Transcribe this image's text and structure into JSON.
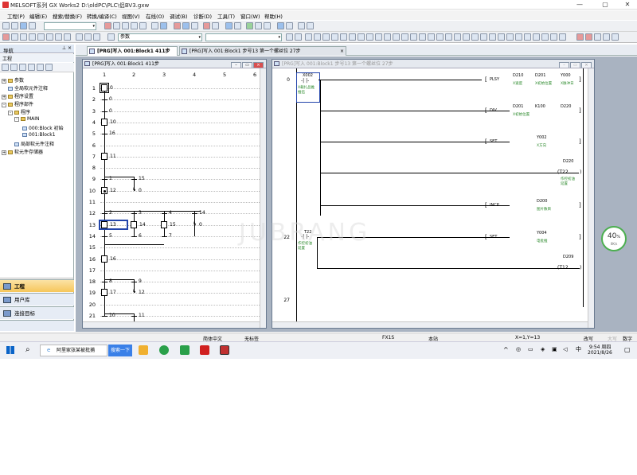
{
  "window": {
    "title": "MELSOFT系列 GX Works2 D:\\oldPC\\PLC\\侣BV3.gxw",
    "min": "—",
    "max": "▢",
    "close": "✕"
  },
  "menu": [
    "工程(P)",
    "编辑(E)",
    "搜索/替换(F)",
    "转换/编译(C)",
    "视图(V)",
    "在线(O)",
    "调试(B)",
    "诊断(D)",
    "工具(T)",
    "窗口(W)",
    "帮助(H)"
  ],
  "toolbar": {
    "combo2_value": "参数"
  },
  "nav": {
    "header": "导航",
    "pin": "⊥ ×",
    "section": "工程",
    "tree": [
      {
        "label": "参数",
        "indent": 0,
        "exp": "+",
        "icon": "folder"
      },
      {
        "label": "全局软元件注释",
        "indent": 0,
        "exp": "",
        "icon": "doc"
      },
      {
        "label": "程序设置",
        "indent": 0,
        "exp": "+",
        "icon": "folder"
      },
      {
        "label": "程序部件",
        "indent": 0,
        "exp": "-",
        "icon": "folder"
      },
      {
        "label": "程序",
        "indent": 1,
        "exp": "-",
        "icon": "folder"
      },
      {
        "label": "MAIN",
        "indent": 2,
        "exp": "-",
        "icon": "folder"
      },
      {
        "label": "000:Block  初始",
        "indent": 3,
        "exp": "",
        "icon": "doc"
      },
      {
        "label": "001:Block1",
        "indent": 3,
        "exp": "",
        "icon": "doc"
      },
      {
        "label": "局部软元件注释",
        "indent": 1,
        "exp": "",
        "icon": "doc"
      },
      {
        "label": "软元件存储器",
        "indent": 0,
        "exp": "+",
        "icon": "folder"
      }
    ],
    "buttons": [
      "工程",
      "用户库",
      "连接目标"
    ]
  },
  "tabs": [
    {
      "label": "[PRG]写入 001:Block1 411步",
      "active": true
    },
    {
      "label": "[PRG]写入 001:Block1 步号13 第一个螺丝位 27步",
      "active": false
    }
  ],
  "sfc_window": {
    "title": "[PRG]写入 001:Block1 411步",
    "columns": [
      "1",
      "2",
      "3",
      "4",
      "5",
      "6"
    ],
    "rows": [
      "1",
      "2",
      "3",
      "4",
      "5",
      "6",
      "7",
      "8",
      "9",
      "10",
      "11",
      "12",
      "13",
      "14",
      "15",
      "16",
      "17",
      "18",
      "19",
      "20",
      "21"
    ],
    "steps": [
      {
        "row": 1,
        "col": 1,
        "label": "0",
        "initial": true
      },
      {
        "row": 4,
        "col": 1,
        "label": "10"
      },
      {
        "row": 7,
        "col": 1,
        "label": "11"
      },
      {
        "row": 10,
        "col": 1,
        "label": "12",
        "active": true
      },
      {
        "row": 13,
        "col": 1,
        "label": "13",
        "selected": true
      },
      {
        "row": 13,
        "col": 2,
        "label": "14"
      },
      {
        "row": 13,
        "col": 3,
        "label": "15"
      },
      {
        "row": 16,
        "col": 1,
        "label": "16"
      },
      {
        "row": 19,
        "col": 1,
        "label": "17"
      }
    ],
    "transitions": [
      {
        "row": 2,
        "col": 1,
        "label": "0"
      },
      {
        "row": 3,
        "col": 1,
        "label": "0"
      },
      {
        "row": 5,
        "col": 1,
        "label": "16"
      },
      {
        "row": 9,
        "col": 1,
        "label": "1"
      },
      {
        "row": 9,
        "col": 2,
        "label": "15"
      },
      {
        "row": 12,
        "col": 1,
        "label": "2"
      },
      {
        "row": 12,
        "col": 2,
        "label": "3"
      },
      {
        "row": 12,
        "col": 3,
        "label": "4"
      },
      {
        "row": 12,
        "col": 4,
        "label": "14"
      },
      {
        "row": 14,
        "col": 1,
        "label": "5"
      },
      {
        "row": 14,
        "col": 2,
        "label": "6"
      },
      {
        "row": 14,
        "col": 3,
        "label": "7"
      },
      {
        "row": 18,
        "col": 1,
        "label": "8"
      },
      {
        "row": 18,
        "col": 2,
        "label": "9"
      },
      {
        "row": 21,
        "col": 1,
        "label": "10"
      },
      {
        "row": 21,
        "col": 2,
        "label": "11"
      }
    ],
    "jumps": [
      {
        "row": 10,
        "col": 2,
        "label": "0"
      },
      {
        "row": 13,
        "col": 4,
        "label": "0"
      },
      {
        "row": 19,
        "col": 2,
        "label": "12"
      }
    ]
  },
  "ladder_window": {
    "title": "[PRG]写入 001:Block1 步号13 第一个螺丝位 27步",
    "step_numbers": [
      "0",
      "22",
      "27"
    ],
    "contacts": [
      {
        "dev": "X002",
        "comment": "X载扎品推\n推伍"
      },
      {
        "dev": "T22",
        "comment": "作控初油\n延置"
      }
    ],
    "instructions": [
      {
        "op": "PLSY",
        "args": [
          "D210",
          "D201",
          "Y000"
        ],
        "comments": [
          "X速度",
          "X初始位置",
          "X脉冲日"
        ]
      },
      {
        "op": "DIV",
        "args": [
          "D201",
          "K100",
          "D220"
        ],
        "comments": [
          "X初始位置",
          "",
          ""
        ]
      },
      {
        "op": "SET",
        "args": [
          "Y002"
        ],
        "comments": [
          "X方向"
        ]
      },
      {
        "op": "INCP",
        "args": [
          "D200"
        ],
        "comments": [
          "图片数目"
        ]
      },
      {
        "op": "SET",
        "args": [
          "Y004"
        ],
        "comments": [
          "电批推"
        ]
      }
    ],
    "coils": [
      {
        "dev": "T22",
        "param": "D220",
        "comment": "作控初油\n延置"
      },
      {
        "dev": "T12",
        "param": "D209",
        "comment": ""
      }
    ]
  },
  "progress": {
    "percent": "40",
    "unit": "%",
    "rate": "0K/s"
  },
  "status": {
    "lang": "简体中文",
    "label": "无标签",
    "plc": "FX1S",
    "station": "本站",
    "cursor": "X=1,Y=13",
    "mode": "改写",
    "caps": "大写",
    "num": "数字"
  },
  "watermark": "JUBRANG",
  "taskbar": {
    "search_placeholder": "阿里家张某被批捕",
    "search_btn": "搜索一下",
    "time": "9:54 周四",
    "date": "2021/8/26",
    "ime": "中"
  }
}
